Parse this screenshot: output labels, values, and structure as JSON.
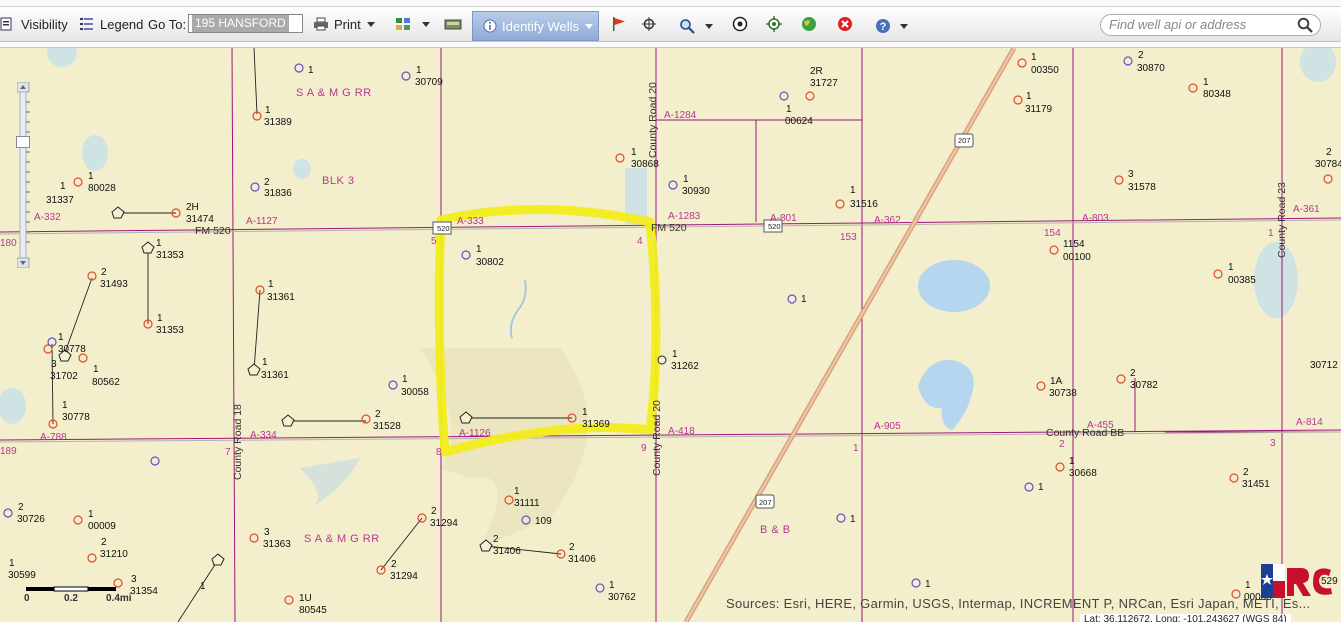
{
  "toolbar": {
    "visibility_label": "Visibility",
    "legend_label": "Legend",
    "goto_label": "Go To:",
    "goto_value": "195 HANSFORD",
    "print_label": "Print",
    "identify_label": "Identify Wells",
    "search_placeholder": "Find well api or address"
  },
  "map": {
    "attribution": "Sources: Esri, HERE, Garmin, USGS, Intermap, INCREMENT P, NRCan, Esri Japan, METI, Es...",
    "coordinates": "Lat: 36.112672, Long: -101.243627 (WGS 84)",
    "scale": {
      "ticks": [
        "0",
        "0.2",
        "0.4mi"
      ]
    },
    "roads": [
      "FM 520",
      "FM 520",
      "County Road 18",
      "County Road 20",
      "County Road 20",
      "County Road 23",
      "County Road BB"
    ],
    "shields": [
      "520",
      "520",
      "207",
      "207"
    ],
    "areas": [
      "S A & M G RR",
      "BLK 3",
      "S A & M G RR",
      "B & B"
    ],
    "abstracts": [
      "A-332",
      "A-1127",
      "A-333",
      "A-1283",
      "A-1284",
      "A-801",
      "A-362",
      "A-803",
      "A-361",
      "A-788",
      "A-334",
      "A-1126",
      "A-418",
      "A-905",
      "A-455",
      "A-814"
    ],
    "sections": [
      "180",
      "189",
      "5",
      "4",
      "153",
      "154",
      "7",
      "8",
      "9",
      "1",
      "2",
      "3",
      "1"
    ],
    "wells": [
      {
        "n": "1",
        "id": ""
      },
      {
        "n": "1",
        "id": "30709"
      },
      {
        "n": "1",
        "id": "31389"
      },
      {
        "n": "2",
        "id": "31836"
      },
      {
        "n": "1",
        "id": "80028"
      },
      {
        "n": "1",
        "id": "31337"
      },
      {
        "n": "2H",
        "id": "31474"
      },
      {
        "n": "1",
        "id": "31353"
      },
      {
        "n": "2",
        "id": "31493"
      },
      {
        "n": "1",
        "id": "31353"
      },
      {
        "n": "1",
        "id": "31361"
      },
      {
        "n": "1",
        "id": "31361"
      },
      {
        "n": "1",
        "id": "30778"
      },
      {
        "n": "3",
        "id": "31702"
      },
      {
        "n": "1",
        "id": "80562"
      },
      {
        "n": "1",
        "id": "30778"
      },
      {
        "n": "1",
        "id": "30058"
      },
      {
        "n": "2",
        "id": "31528"
      },
      {
        "n": "1",
        "id": "30802"
      },
      {
        "n": "1",
        "id": "31369"
      },
      {
        "n": "1",
        "id": "31262"
      },
      {
        "n": "1",
        "id": "30868"
      },
      {
        "n": "1",
        "id": "30930"
      },
      {
        "n": "2R",
        "id": "31727"
      },
      {
        "n": "1",
        "id": "00624"
      },
      {
        "n": "1",
        "id": "31516"
      },
      {
        "n": "1",
        "id": ""
      },
      {
        "n": "1",
        "id": "00350"
      },
      {
        "n": "1",
        "id": "31179"
      },
      {
        "n": "2",
        "id": "30870"
      },
      {
        "n": "1",
        "id": "80348"
      },
      {
        "n": "3",
        "id": "31578"
      },
      {
        "n": "1154",
        "id": "00100"
      },
      {
        "n": "1",
        "id": "00385"
      },
      {
        "n": "2",
        "id": "30784"
      },
      {
        "n": "1A",
        "id": "30738"
      },
      {
        "n": "2",
        "id": "30782"
      },
      {
        "n": "30712",
        "id": ""
      },
      {
        "n": "1",
        "id": "30668"
      },
      {
        "n": "2",
        "id": "31451"
      },
      {
        "n": "1",
        "id": ""
      },
      {
        "n": "1",
        "id": ""
      },
      {
        "n": "1",
        "id": ""
      },
      {
        "n": "1",
        "id": "00008"
      },
      {
        "n": "1",
        "id": "31111"
      },
      {
        "n": "109",
        "id": ""
      },
      {
        "n": "2",
        "id": "31406"
      },
      {
        "n": "2",
        "id": "31406"
      },
      {
        "n": "2",
        "id": "31294"
      },
      {
        "n": "2",
        "id": "31294"
      },
      {
        "n": "3",
        "id": "31363"
      },
      {
        "n": "1U",
        "id": "80545"
      },
      {
        "n": "1",
        "id": "30762"
      },
      {
        "n": "2",
        "id": "30726"
      },
      {
        "n": "1",
        "id": "00009"
      },
      {
        "n": "2",
        "id": "31210"
      },
      {
        "n": "1",
        "id": "30599"
      },
      {
        "n": "3",
        "id": "31354"
      },
      {
        "n": "1",
        "id": ""
      },
      {
        "n": "529",
        "id": ""
      }
    ]
  },
  "colors": {
    "highlight": "#f2ec1c",
    "section_line": "#a0157e",
    "road": "#d9a17d",
    "well_oil": "#e04b2a",
    "well_gas": "#5c55c8",
    "water": "#b8d8f0"
  }
}
